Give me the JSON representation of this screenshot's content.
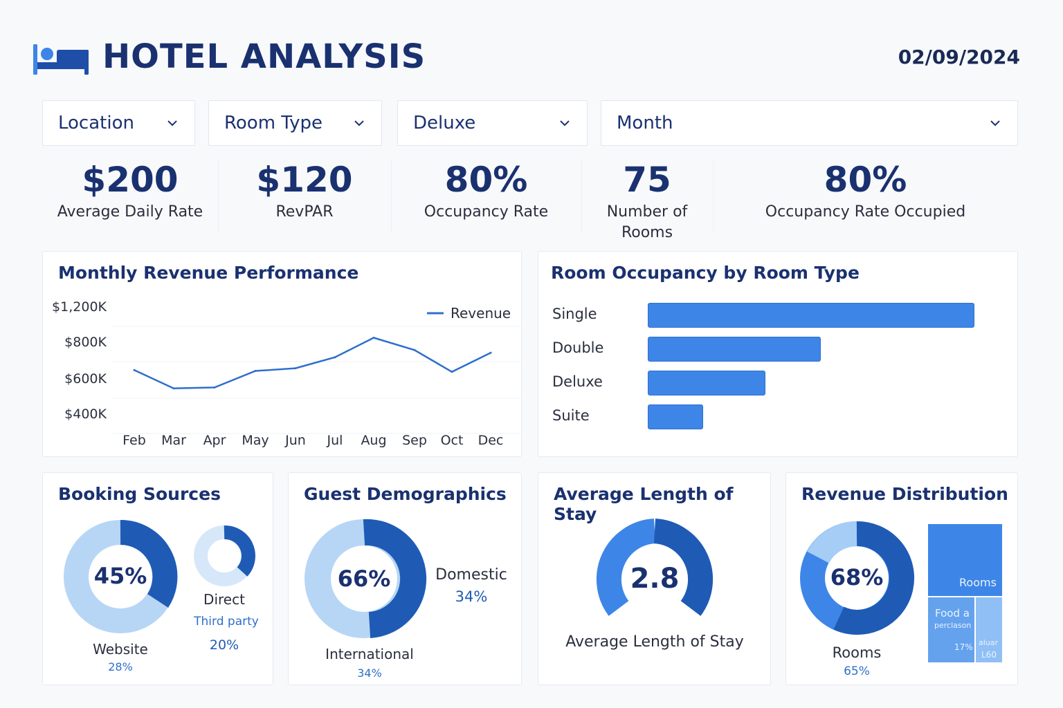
{
  "header": {
    "title": "HOTEL ANALYSIS",
    "date": "02/09/2024"
  },
  "filters": [
    {
      "label": "Location"
    },
    {
      "label": "Room Type"
    },
    {
      "label": "Deluxe"
    },
    {
      "label": "Month"
    }
  ],
  "kpis": [
    {
      "value": "$200",
      "label": "Average Daily Rate"
    },
    {
      "value": "$120",
      "label": "RevPAR"
    },
    {
      "value": "80%",
      "label": "Occupancy Rate"
    },
    {
      "value": "75",
      "label_line1": "Number of",
      "label_line2": "Rooms"
    },
    {
      "value": "80%",
      "label": "Occupancy Rate Occupied"
    }
  ],
  "revenue_card": {
    "title": "Monthly Revenue Performance",
    "legend": "Revenue"
  },
  "occupancy_card": {
    "title": "Room Occupancy by Room Type"
  },
  "booking_card": {
    "title": "Booking Sources",
    "center": "45%",
    "website_label": "Website",
    "website_value": "28%",
    "direct_label": "Direct",
    "third_label": "Third party",
    "third_value": "20%"
  },
  "guest_card": {
    "title": "Guest Demographics",
    "center": "66%",
    "domestic_label": "Domestic",
    "domestic_value": "34%",
    "international_label": "International",
    "international_value": "34%"
  },
  "stay_card": {
    "title": "Average Length of Stay",
    "value": "2.8",
    "label": "Average Length of Stay"
  },
  "distribution_card": {
    "title": "Revenue Distribution",
    "center": "68%",
    "rooms_label": "Rooms",
    "rooms_value": "65%",
    "tile_rooms": "Rooms",
    "tile_food_1": "Food a",
    "tile_food_2": "perclason",
    "tile_food_pct": "17%",
    "tile_other_1": "aluar",
    "tile_other_2": "L60"
  },
  "colors": {
    "dark": "#1f5bb5",
    "mid": "#3d86e8",
    "light": "#b7d6f5",
    "text": "#1a3170"
  },
  "chart_data": [
    {
      "type": "line",
      "title": "Monthly Revenue Performance",
      "x": [
        "Feb",
        "Mar",
        "Apr",
        "May",
        "Jun",
        "Jul",
        "Aug",
        "Sep",
        "Oct",
        "Dec"
      ],
      "series": [
        {
          "name": "Revenue",
          "values": [
            720,
            620,
            625,
            715,
            730,
            790,
            1000,
            860,
            710,
            830
          ]
        }
      ],
      "yticks": [
        "$1,200K",
        "$800K",
        "$600K",
        "$400K"
      ],
      "legend": "top-right",
      "grid": true
    },
    {
      "type": "bar",
      "title": "Room Occupancy by Room Type",
      "orientation": "horizontal",
      "categories": [
        "Single",
        "Double",
        "Deluxe",
        "Suite"
      ],
      "values": [
        100,
        53,
        36,
        17
      ]
    }
  ]
}
